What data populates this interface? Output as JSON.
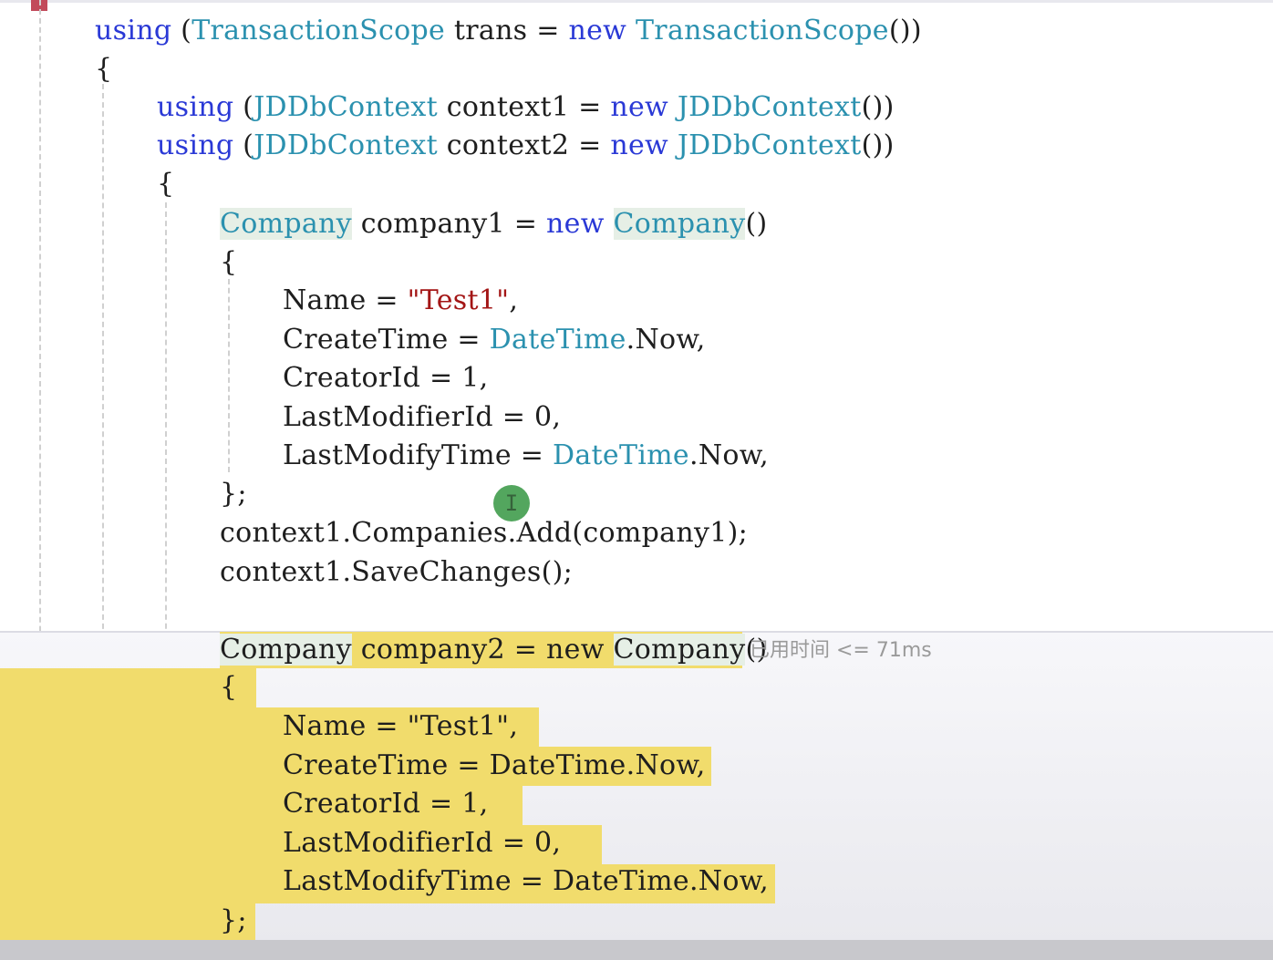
{
  "code": {
    "lines": [
      [
        {
          "t": "using",
          "c": "kw"
        },
        {
          "t": " (",
          "c": "plain"
        },
        {
          "t": "TransactionScope",
          "c": "ty"
        },
        {
          "t": " trans = ",
          "c": "plain"
        },
        {
          "t": "new",
          "c": "kw"
        },
        {
          "t": " ",
          "c": "plain"
        },
        {
          "t": "TransactionScope",
          "c": "ty"
        },
        {
          "t": "())",
          "c": "plain"
        }
      ],
      [
        {
          "t": "{",
          "c": "plain"
        }
      ],
      [
        {
          "t": "using",
          "c": "kw"
        },
        {
          "t": " (",
          "c": "plain"
        },
        {
          "t": "JDDbContext",
          "c": "ty"
        },
        {
          "t": " context1 = ",
          "c": "plain"
        },
        {
          "t": "new",
          "c": "kw"
        },
        {
          "t": " ",
          "c": "plain"
        },
        {
          "t": "JDDbContext",
          "c": "ty"
        },
        {
          "t": "())",
          "c": "plain"
        }
      ],
      [
        {
          "t": "using",
          "c": "kw"
        },
        {
          "t": " (",
          "c": "plain"
        },
        {
          "t": "JDDbContext",
          "c": "ty"
        },
        {
          "t": " context2 = ",
          "c": "plain"
        },
        {
          "t": "new",
          "c": "kw"
        },
        {
          "t": " ",
          "c": "plain"
        },
        {
          "t": "JDDbContext",
          "c": "ty"
        },
        {
          "t": "())",
          "c": "plain"
        }
      ],
      [
        {
          "t": "{",
          "c": "plain"
        }
      ],
      [
        {
          "t": "Company",
          "c": "ty ref-bg"
        },
        {
          "t": " company1 = ",
          "c": "plain"
        },
        {
          "t": "new",
          "c": "kw"
        },
        {
          "t": " ",
          "c": "plain"
        },
        {
          "t": "Company",
          "c": "ty ref-bg"
        },
        {
          "t": "()",
          "c": "plain"
        }
      ],
      [
        {
          "t": "{",
          "c": "plain"
        }
      ],
      [
        {
          "t": "Name = ",
          "c": "plain"
        },
        {
          "t": "\"Test1\"",
          "c": "str"
        },
        {
          "t": ",",
          "c": "plain"
        }
      ],
      [
        {
          "t": "CreateTime = ",
          "c": "plain"
        },
        {
          "t": "DateTime",
          "c": "ty"
        },
        {
          "t": ".Now,",
          "c": "plain"
        }
      ],
      [
        {
          "t": "CreatorId = 1,",
          "c": "plain"
        }
      ],
      [
        {
          "t": "LastModifierId = 0,",
          "c": "plain"
        }
      ],
      [
        {
          "t": "LastModifyTime = ",
          "c": "plain"
        },
        {
          "t": "DateTime",
          "c": "ty"
        },
        {
          "t": ".Now,",
          "c": "plain"
        }
      ],
      [
        {
          "t": "};",
          "c": "plain"
        }
      ],
      [
        {
          "t": "context1.Companies.Add(company1);",
          "c": "plain"
        }
      ],
      [
        {
          "t": "context1.SaveChanges();",
          "c": "plain"
        }
      ],
      [
        {
          "t": "Company",
          "c": "plain ref-bg"
        },
        {
          "t": " company2 = new ",
          "c": "plain"
        },
        {
          "t": "Company",
          "c": "plain ref-bg"
        },
        {
          "t": "()",
          "c": "plain"
        }
      ],
      [
        {
          "t": "{",
          "c": "plain"
        }
      ],
      [
        {
          "t": "Name = \"Test1\",",
          "c": "plain"
        }
      ],
      [
        {
          "t": "CreateTime = DateTime.Now,",
          "c": "plain"
        }
      ],
      [
        {
          "t": "CreatorId = 1,",
          "c": "plain"
        }
      ],
      [
        {
          "t": "LastModifierId = 0,",
          "c": "plain"
        }
      ],
      [
        {
          "t": "LastModifyTime = DateTime.Now,",
          "c": "plain"
        }
      ],
      [
        {
          "t": "};",
          "c": "plain"
        }
      ]
    ]
  },
  "perf_tip": "已用时间 <= 71ms",
  "cursor_glyph": "I",
  "colors": {
    "keyword": "#2a39d6",
    "type": "#2b91af",
    "string": "#a31515",
    "text": "#1e1e1e",
    "execution_highlight": "#f1dc6c"
  }
}
